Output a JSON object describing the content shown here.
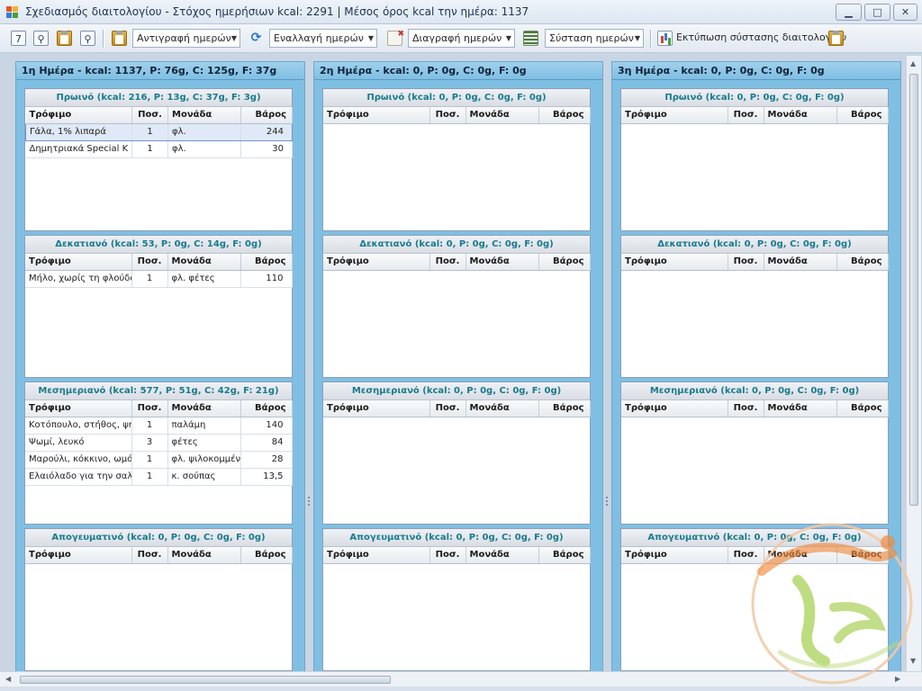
{
  "window": {
    "title": "Σχεδιασμός διαιτολογίου - Στόχος ημερήσιων kcal: 2291 | Μέσος όρος kcal την ημέρα: 1137",
    "minimize_label": "▁",
    "maximize_label": "□",
    "close_label": "✕"
  },
  "toolbar": {
    "calendar_label": "7",
    "copy_days_label": "Αντιγραφή ημερών",
    "swap_days_label": "Εναλλαγή ημερών",
    "delete_days_label": "Διαγραφή ημερών",
    "day_composition_label": "Σύσταση ημερών",
    "print_label": "Εκτύπωση σύστασης διαιτολογίου",
    "dropdown_arrow": "▼",
    "search_glyph": "⚲",
    "sync_glyph": "⟳"
  },
  "columns": {
    "food": "Τρόφιμο",
    "qty": "Ποσ.",
    "unit": "Μονάδα",
    "weight": "Βάρος"
  },
  "days": [
    {
      "header": "1η Ημέρα - kcal: 1137, P: 76g, C: 125g, F: 37g",
      "meals": [
        {
          "title": "Πρωινό (kcal: 216, P: 13g, C: 37g, F: 3g)",
          "rows": [
            {
              "food": "Γάλα, 1% λιπαρά",
              "qty": "1",
              "unit": "φλ.",
              "weight": "244",
              "selected": true
            },
            {
              "food": "Δημητριακά Special K",
              "qty": "1",
              "unit": "φλ.",
              "weight": "30"
            }
          ]
        },
        {
          "title": "Δεκατιανό (kcal: 53, P: 0g, C: 14g, F: 0g)",
          "rows": [
            {
              "food": "Μήλο, χωρίς τη φλούδα",
              "qty": "1",
              "unit": "φλ. φέτες",
              "weight": "110"
            }
          ]
        },
        {
          "title": "Μεσημεριανό (kcal: 577, P: 51g, C: 42g, F: 21g)",
          "rows": [
            {
              "food": "Κοτόπουλο, στήθος, ψητό",
              "qty": "1",
              "unit": "παλάμη",
              "weight": "140"
            },
            {
              "food": "Ψωμί, λευκό",
              "qty": "3",
              "unit": "φέτες",
              "weight": "84"
            },
            {
              "food": "Μαρούλι, κόκκινο, ωμό",
              "qty": "1",
              "unit": "φλ. ψιλοκομμένο",
              "weight": "28"
            },
            {
              "food": "Ελαιόλαδο για την σαλάτα",
              "qty": "1",
              "unit": "κ. σούπας",
              "weight": "13,5"
            }
          ]
        },
        {
          "title": "Απογευματινό (kcal: 0, P: 0g, C: 0g, F: 0g)",
          "rows": []
        }
      ]
    },
    {
      "header": "2η Ημέρα - kcal: 0, P: 0g, C: 0g, F: 0g",
      "meals": [
        {
          "title": "Πρωινό (kcal: 0, P: 0g, C: 0g, F: 0g)",
          "rows": []
        },
        {
          "title": "Δεκατιανό (kcal: 0, P: 0g, C: 0g, F: 0g)",
          "rows": []
        },
        {
          "title": "Μεσημεριανό (kcal: 0, P: 0g, C: 0g, F: 0g)",
          "rows": []
        },
        {
          "title": "Απογευματινό (kcal: 0, P: 0g, C: 0g, F: 0g)",
          "rows": []
        }
      ]
    },
    {
      "header": "3η Ημέρα - kcal: 0, P: 0g, C: 0g, F: 0g",
      "meals": [
        {
          "title": "Πρωινό (kcal: 0, P: 0g, C: 0g, F: 0g)",
          "rows": []
        },
        {
          "title": "Δεκατιανό (kcal: 0, P: 0g, C: 0g, F: 0g)",
          "rows": []
        },
        {
          "title": "Μεσημεριανό (kcal: 0, P: 0g, C: 0g, F: 0g)",
          "rows": []
        },
        {
          "title": "Απογευματινό (kcal: 0, P: 0g, C: 0g, F: 0g)",
          "rows": []
        }
      ]
    }
  ],
  "scroll": {
    "up": "▲",
    "down": "▼",
    "left": "◀",
    "right": "▶"
  },
  "colors": {
    "day_header": "#7fbfe3",
    "meal_title_text": "#197a8e",
    "selected_row": "#dfe9f8",
    "logo_orange": "#f08a3c",
    "logo_green": "#9ac93a"
  }
}
